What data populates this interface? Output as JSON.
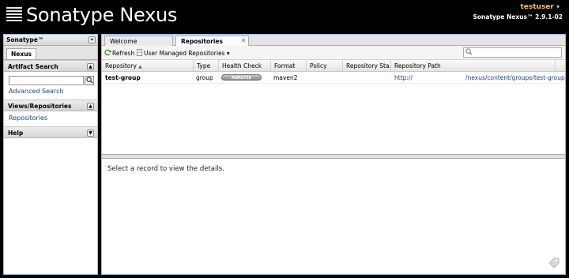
{
  "header": {
    "app_name": "Sonatype Nexus",
    "user": "testuser",
    "user_caret": "▾",
    "version": "Sonatype Nexus™ 2.9.1-02"
  },
  "sidebar": {
    "title": "Sonatype™",
    "collapse_glyph": "«",
    "tab": "Nexus",
    "sections": {
      "artifact_search": {
        "title": "Artifact Search",
        "link": "Advanced Search",
        "search_value": ""
      },
      "views": {
        "title": "Views/Repositories",
        "link": "Repositories"
      },
      "help": {
        "title": "Help"
      }
    }
  },
  "main": {
    "tabs": [
      {
        "label": "Welcome"
      },
      {
        "label": "Repositories",
        "close": "×"
      }
    ],
    "toolbar": {
      "refresh": "Refresh",
      "user_managed": "User Managed Repositories",
      "filter_value": ""
    },
    "columns": [
      "Repository",
      "Type",
      "Health Check",
      "Format",
      "Policy",
      "Repository Sta...",
      "Repository Path"
    ],
    "sort_indicator": "▲",
    "rows": [
      {
        "repository": "test-group",
        "type": "group",
        "health_check": "ANALYZE",
        "format": "maven2",
        "policy": "",
        "status": "",
        "path_prefix": "http://",
        "path_suffix": "/nexus/content/groups/test-group"
      }
    ],
    "detail_message": "Select a record to view the details."
  },
  "colors": {
    "header_bg": "#000000",
    "user_accent": "#f5c542",
    "link": "#15428b",
    "panel_border": "#99bbe8"
  }
}
